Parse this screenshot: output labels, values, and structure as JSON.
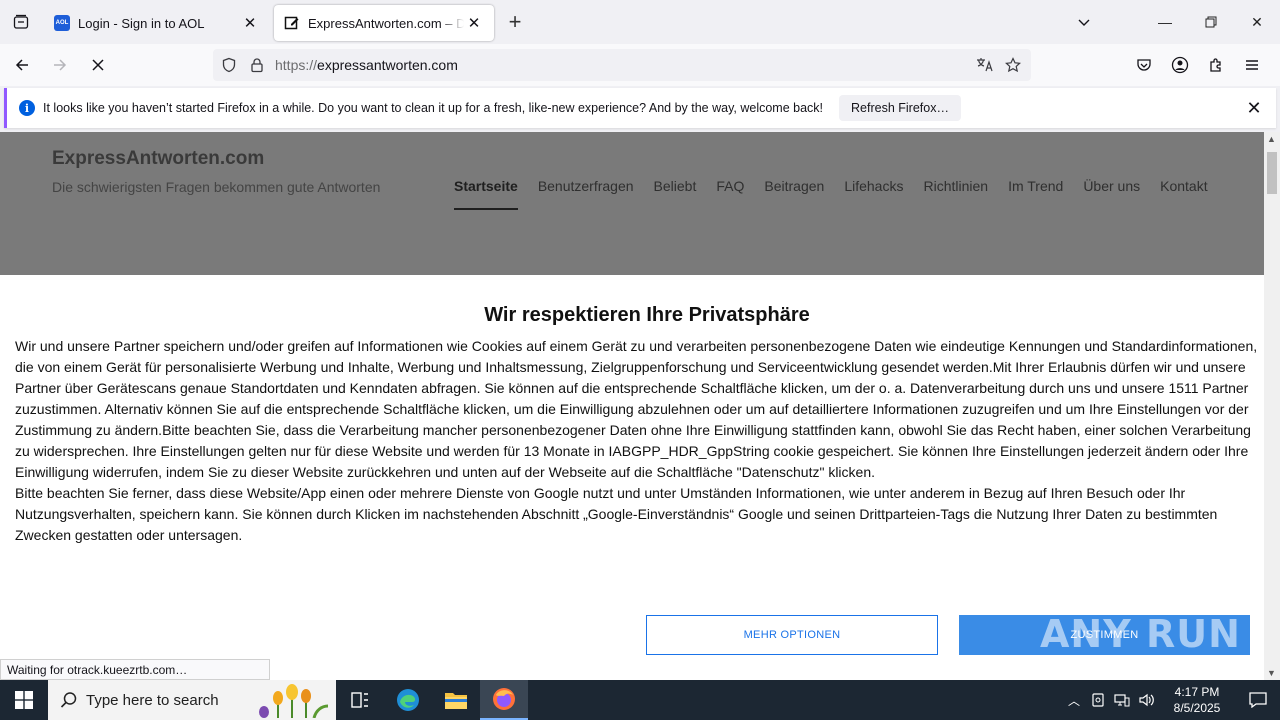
{
  "browser": {
    "tabs": [
      {
        "title": "Login - Sign in to AOL",
        "favicon": "aol-icon",
        "active": false
      },
      {
        "title": "ExpressAntworten.com – Die schwierigsten Fragen",
        "favicon": "edit-icon",
        "active": true
      }
    ],
    "url_proto": "https://",
    "url_host": "expressantworten.com",
    "aol_favicon_text": "AOL"
  },
  "notification": {
    "message": "It looks like you haven’t started Firefox in a while. Do you want to clean it up for a fresh, like-new experience? And by the way, welcome back!",
    "button": "Refresh Firefox…",
    "info_glyph": "i"
  },
  "site": {
    "title": "ExpressAntworten.com",
    "tagline": "Die schwierigsten Fragen bekommen gute Antworten",
    "nav": [
      "Startseite",
      "Benutzerfragen",
      "Beliebt",
      "FAQ",
      "Beitragen",
      "Lifehacks",
      "Richtlinien",
      "Im Trend",
      "Über uns",
      "Kontakt"
    ]
  },
  "consent": {
    "heading": "Wir respektieren Ihre Privatsphäre",
    "paragraph1": "Wir und unsere Partner speichern und/oder greifen auf Informationen wie Cookies auf einem Gerät zu und verarbeiten personenbezogene Daten wie eindeutige Kennungen und Standardinformationen, die von einem Gerät für personalisierte Werbung und Inhalte, Werbung und Inhaltsmessung, Zielgruppenforschung und Serviceentwicklung gesendet werden.Mit Ihrer Erlaubnis dürfen wir und unsere Partner über Gerätescans genaue Standortdaten und Kenndaten abfragen. Sie können auf die entsprechende Schaltfläche klicken, um der o. a. Datenverarbeitung durch uns und unsere 1511 Partner zuzustimmen. Alternativ können Sie auf die entsprechende Schaltfläche klicken, um die Einwilligung abzulehnen oder um auf detailliertere Informationen zuzugreifen und um Ihre Einstellungen vor der Zustimmung zu ändern.Bitte beachten Sie, dass die Verarbeitung mancher personenbezogener Daten ohne Ihre Einwilligung stattfinden kann, obwohl Sie das Recht haben, einer solchen Verarbeitung zu widersprechen. Ihre Einstellungen gelten nur für diese Website und werden für 13 Monate in IABGPP_HDR_GppString cookie gespeichert. Sie können Ihre Einstellungen jederzeit ändern oder Ihre Einwilligung widerrufen, indem Sie zu dieser Website zurückkehren und unten auf der Webseite auf die Schaltfläche \"Datenschutz\" klicken.",
    "paragraph2": "Bitte beachten Sie ferner, dass diese Website/App einen oder mehrere Dienste von Google nutzt und unter Umständen Informationen, wie unter anderem in Bezug auf Ihren Besuch oder Ihr Nutzungsverhalten, speichern kann. Sie können durch Klicken im nachstehenden Abschnitt „Google-Einverständnis“ Google und seinen Drittparteien-Tags die Nutzung Ihrer Daten zu bestimmten Zwecken gestatten oder untersagen.",
    "btn_more": "MEHR OPTIONEN",
    "btn_agree": "ZUSTIMMEN"
  },
  "status_text": "Waiting for otrack.kueezrtb.com…",
  "watermark": "ANY RUN",
  "taskbar": {
    "search_placeholder": "Type here to search",
    "time": "4:17 PM",
    "date": "8/5/2025"
  },
  "colors": {
    "accent": "#1a73e8",
    "agree_button": "#3a8ce6",
    "notification_border": "#9059ff",
    "header_overlay": "#7a7a7a",
    "taskbar": "#1c2733"
  }
}
